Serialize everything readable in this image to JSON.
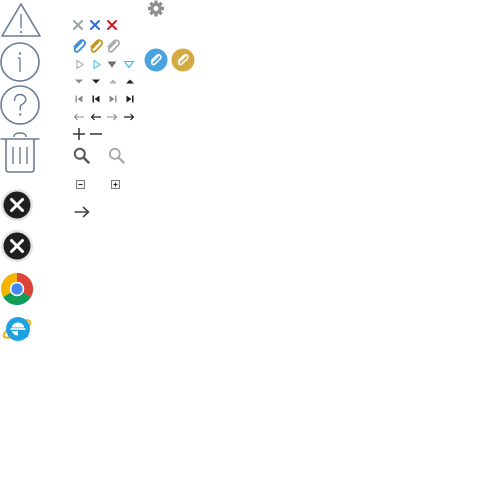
{
  "sheet": {
    "large_icons": [
      {
        "name": "warning-icon"
      },
      {
        "name": "info-icon"
      },
      {
        "name": "help-icon"
      },
      {
        "name": "trash-icon"
      },
      {
        "name": "close-circle-icon"
      },
      {
        "name": "close-circle-hover-icon"
      },
      {
        "name": "chrome-browser-icon"
      },
      {
        "name": "internet-explorer-icon"
      }
    ],
    "small_icons": {
      "close": [
        "close-gray-icon",
        "close-blue-icon",
        "close-red-icon"
      ],
      "attach": [
        "paperclip-blue-icon",
        "paperclip-gold-icon",
        "paperclip-gray-icon"
      ],
      "attach_badges": [
        "paperclip-badge-blue-icon",
        "paperclip-badge-gold-icon"
      ],
      "settings": "gear-icon",
      "disclosure": [
        "triangle-right-outline-icon",
        "triangle-right-blue-icon",
        "triangle-down-gray-icon",
        "triangle-down-cyan-icon"
      ],
      "carets": [
        "caret-down-gray-icon",
        "caret-down-dark-icon",
        "caret-up-gray-icon",
        "caret-up-dark-icon"
      ],
      "skip": [
        "skip-first-gray-icon",
        "skip-first-dark-icon",
        "skip-last-gray-icon",
        "skip-last-dark-icon"
      ],
      "arrows": [
        "arrow-left-gray-icon",
        "arrow-left-dark-icon",
        "arrow-right-gray-icon",
        "arrow-right-dark-icon"
      ],
      "plus_minus": [
        "plus-icon",
        "minus-icon"
      ],
      "search": [
        "search-dark-icon",
        "search-light-icon"
      ],
      "toggles": [
        "collapse-box-icon",
        "expand-box-icon"
      ],
      "big_arrow": "arrow-right-large-icon"
    },
    "colors": {
      "outline": "#6b7c93",
      "gray": "#9aa0a6",
      "dark": "#333333",
      "blue": "#2f6fd1",
      "red": "#d6181e",
      "clip_blue": "#3b8ed6",
      "clip_gold": "#c8951f",
      "badge_blue": "#4aa3df",
      "badge_gold": "#d4aa45",
      "cyan": "#35b8e6"
    }
  }
}
